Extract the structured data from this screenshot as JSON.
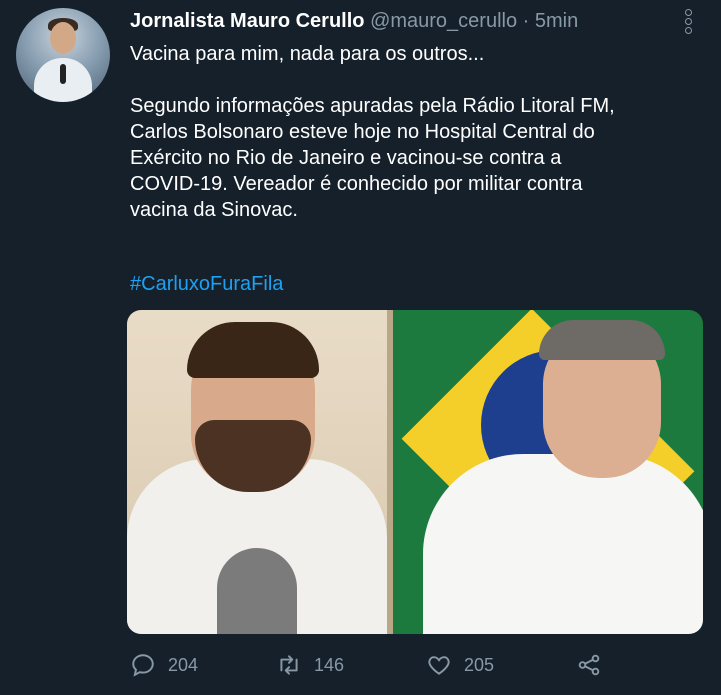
{
  "tweet": {
    "author_name": "Jornalista Mauro Cerullo",
    "handle": "@mauro_cerullo",
    "separator": "·",
    "time": "5min",
    "lines": [
      "Vacina para mim, nada para os outros...",
      "",
      "Segundo informações apuradas pela Rádio Litoral FM,",
      "Carlos Bolsonaro esteve hoje no Hospital Central do",
      "Exército no Rio de Janeiro e vacinou-se contra a",
      "COVID-19. Vereador é conhecido por militar contra",
      "vacina da Sinovac."
    ],
    "hashtag": "#CarluxoFuraFila"
  },
  "actions": {
    "replies": "204",
    "retweets": "146",
    "likes": "205"
  },
  "icons": {
    "reply": "comment-icon",
    "retweet": "retweet-icon",
    "like": "heart-icon",
    "share": "share-icon",
    "more": "more-options-icon"
  },
  "colors": {
    "background": "#15202b",
    "text": "#ffffff",
    "secondary": "#8899a6",
    "link": "#1da1f2"
  }
}
